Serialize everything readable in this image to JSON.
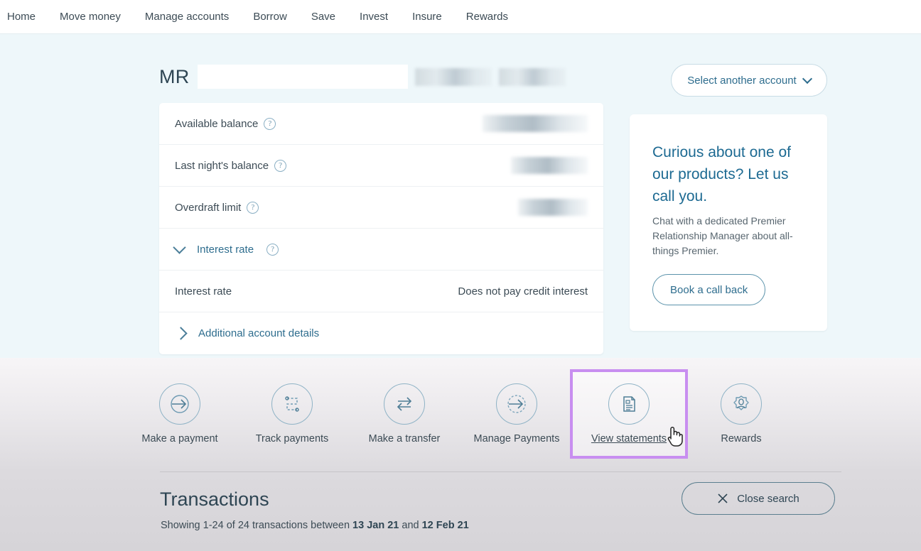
{
  "nav": {
    "items": [
      {
        "label": "Home"
      },
      {
        "label": "Move money"
      },
      {
        "label": "Manage accounts"
      },
      {
        "label": "Borrow"
      },
      {
        "label": "Save"
      },
      {
        "label": "Invest"
      },
      {
        "label": "Insure"
      },
      {
        "label": "Rewards"
      }
    ]
  },
  "account": {
    "title": "MR",
    "select_another_label": "Select another account"
  },
  "details": {
    "rows": [
      {
        "label": "Available balance",
        "value": "",
        "redacted": true
      },
      {
        "label": "Last night's balance",
        "value": "",
        "redacted": true
      },
      {
        "label": "Overdraft limit",
        "value": "",
        "redacted": true
      }
    ],
    "interest_section_label": "Interest rate",
    "interest_row_label": "Interest rate",
    "interest_row_value": "Does not pay credit interest",
    "additional_details_label": "Additional account details"
  },
  "promo": {
    "title": "Curious about one of our products? Let us call you.",
    "body": "Chat with a dedicated Premier Relationship Manager about all-things Premier.",
    "button_label": "Book a call back"
  },
  "actions": [
    {
      "label": "Make a payment",
      "icon": "arrow-into-circle-icon",
      "highlighted": false
    },
    {
      "label": "Track payments",
      "icon": "dashed-route-icon",
      "highlighted": false
    },
    {
      "label": "Make a transfer",
      "icon": "two-way-arrows-icon",
      "highlighted": false
    },
    {
      "label": "Manage Payments",
      "icon": "dashed-arrow-circle-icon",
      "highlighted": false
    },
    {
      "label": "View statements",
      "icon": "document-icon",
      "highlighted": true
    },
    {
      "label": "Rewards",
      "icon": "rosette-person-icon",
      "highlighted": false
    }
  ],
  "transactions": {
    "title": "Transactions",
    "showing_prefix": "Showing 1-24 of 24 transactions between ",
    "date_from": "13 Jan 21",
    "showing_mid": " and ",
    "date_to": "12 Feb 21",
    "close_search_label": "Close search"
  },
  "colors": {
    "highlight": "#c88ef0",
    "page_background": "#eef7fa",
    "accent_blue": "#2e6d8e",
    "promo_title": "#1d6a92"
  }
}
